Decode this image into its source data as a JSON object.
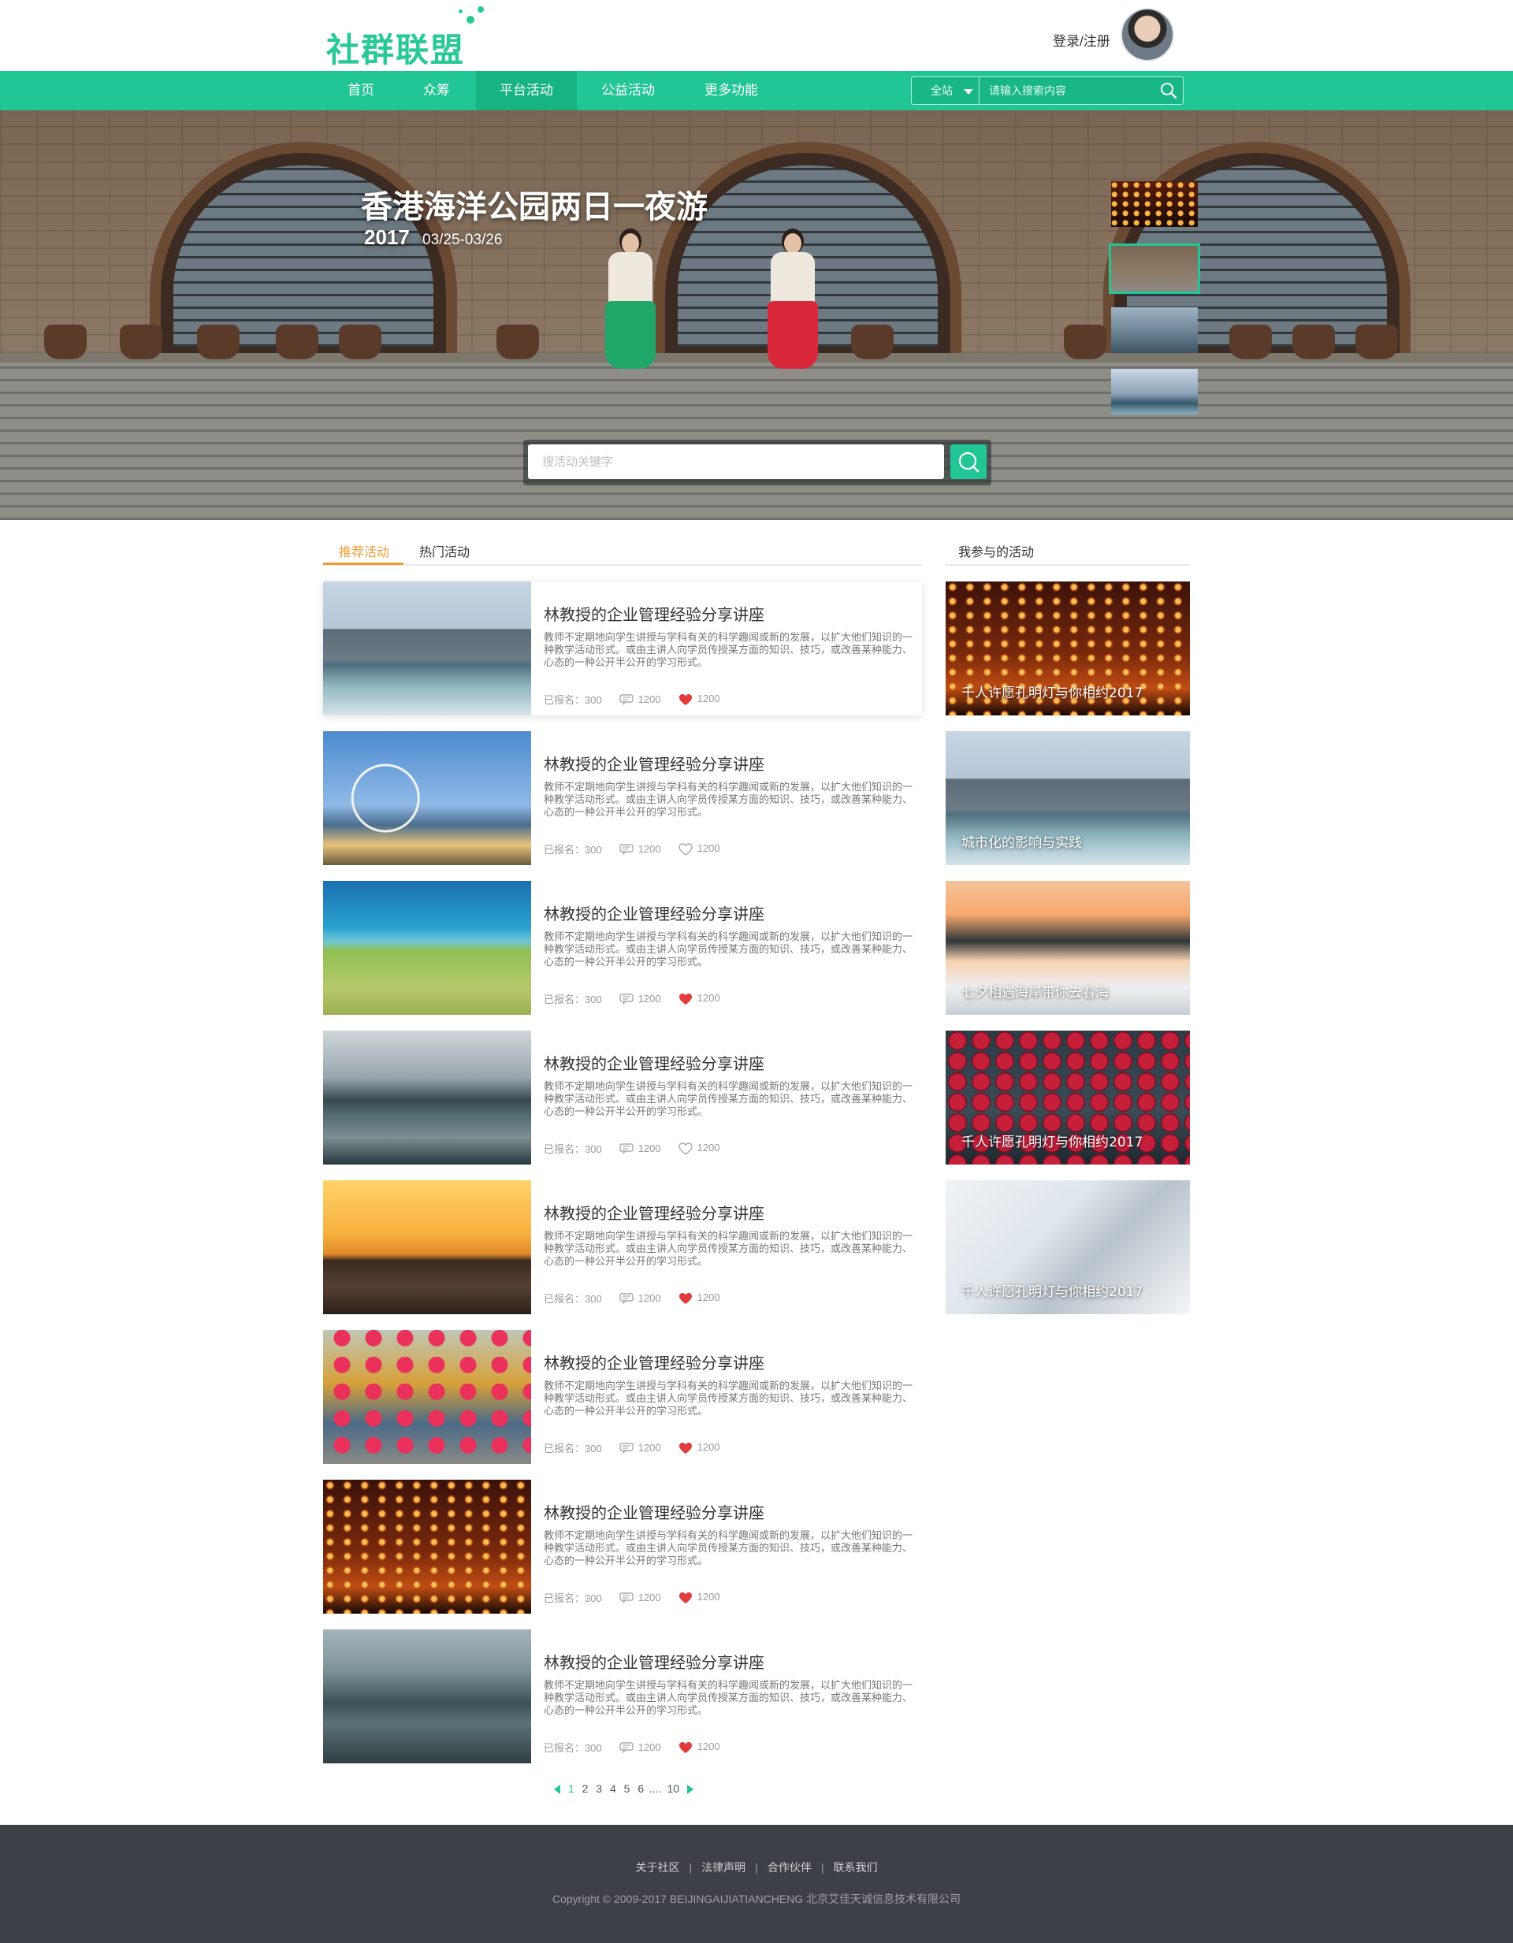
{
  "header": {
    "logo_text": "社群联盟",
    "login_label": "登录/注册"
  },
  "nav": {
    "items": [
      {
        "label": "首页"
      },
      {
        "label": "众筹"
      },
      {
        "label": "平台活动",
        "active": true
      },
      {
        "label": "公益活动"
      },
      {
        "label": "更多功能"
      }
    ],
    "search": {
      "scope_label": "全站",
      "placeholder": "请输入搜索内容"
    }
  },
  "hero": {
    "title": "香港海洋公园两日一夜游",
    "year": "2017",
    "dates": "03/25-03/26",
    "search_placeholder": "搜活动关键字",
    "thumbnails": [
      "lanterns",
      "village",
      "mountains",
      "city"
    ],
    "active_thumbnail": 1
  },
  "tabs": {
    "items": [
      {
        "label": "推荐活动",
        "active": true
      },
      {
        "label": "热门活动"
      }
    ],
    "side_label": "我参与的活动"
  },
  "activities": [
    {
      "title": "林教授的企业管理经验分享讲座",
      "desc": "教师不定期地向学生讲授与学科有关的科学趣闻或新的发展，以扩大他们知识的一种教学活动形式。或由主讲人向学员传授某方面的知识、技巧，或改善某种能力、心态的一种公开半公开的学习形式。",
      "registered": "已报名：300",
      "comments": "1200",
      "likes": "1200",
      "liked": true,
      "image": "city"
    },
    {
      "title": "林教授的企业管理经验分享讲座",
      "desc": "教师不定期地向学生讲授与学科有关的科学趣闻或新的发展，以扩大他们知识的一种教学活动形式。或由主讲人向学员传授某方面的知识、技巧，或改善某种能力、心态的一种公开半公开的学习形式。",
      "registered": "已报名：300",
      "comments": "1200",
      "likes": "1200",
      "liked": false,
      "image": "ferris"
    },
    {
      "title": "林教授的企业管理经验分享讲座",
      "desc": "教师不定期地向学生讲授与学科有关的科学趣闻或新的发展，以扩大他们知识的一种教学活动形式。或由主讲人向学员传授某方面的知识、技巧，或改善某种能力、心态的一种公开半公开的学习形式。",
      "registered": "已报名：300",
      "comments": "1200",
      "likes": "1200",
      "liked": true,
      "image": "coast"
    },
    {
      "title": "林教授的企业管理经验分享讲座",
      "desc": "教师不定期地向学生讲授与学科有关的科学趣闻或新的发展，以扩大他们知识的一种教学活动形式。或由主讲人向学员传授某方面的知识、技巧，或改善某种能力、心态的一种公开半公开的学习形式。",
      "registered": "已报名：300",
      "comments": "1200",
      "likes": "1200",
      "liked": false,
      "image": "lake"
    },
    {
      "title": "林教授的企业管理经验分享讲座",
      "desc": "教师不定期地向学生讲授与学科有关的科学趣闻或新的发展，以扩大他们知识的一种教学活动形式。或由主讲人向学员传授某方面的知识、技巧，或改善某种能力、心态的一种公开半公开的学习形式。",
      "registered": "已报名：300",
      "comments": "1200",
      "likes": "1200",
      "liked": true,
      "image": "sunset"
    },
    {
      "title": "林教授的企业管理经验分享讲座",
      "desc": "教师不定期地向学生讲授与学科有关的科学趣闻或新的发展，以扩大他们知识的一种教学活动形式。或由主讲人向学员传授某方面的知识、技巧，或改善某种能力、心态的一种公开半公开的学习形式。",
      "registered": "已报名：300",
      "comments": "1200",
      "likes": "1200",
      "liked": true,
      "image": "flowers"
    },
    {
      "title": "林教授的企业管理经验分享讲座",
      "desc": "教师不定期地向学生讲授与学科有关的科学趣闻或新的发展，以扩大他们知识的一种教学活动形式。或由主讲人向学员传授某方面的知识、技巧，或改善某种能力、心态的一种公开半公开的学习形式。",
      "registered": "已报名：300",
      "comments": "1200",
      "likes": "1200",
      "liked": true,
      "image": "lanterns"
    },
    {
      "title": "林教授的企业管理经验分享讲座",
      "desc": "教师不定期地向学生讲授与学科有关的科学趣闻或新的发展，以扩大他们知识的一种教学活动形式。或由主讲人向学员传授某方面的知识、技巧，或改善某种能力、心态的一种公开半公开的学习形式。",
      "registered": "已报名：300",
      "comments": "1200",
      "likes": "1200",
      "liked": true,
      "image": "mountains"
    }
  ],
  "my_activities": [
    {
      "title": "千人许愿孔明灯与你相约2017",
      "image": "lanterns"
    },
    {
      "title": "城市化的影响与实践",
      "image": "city"
    },
    {
      "title": "七夕相遇海岸带你去看海",
      "image": "snowriver"
    },
    {
      "title": "千人许愿孔明灯与你相约2017",
      "image": "berries"
    },
    {
      "title": "千人许愿孔明灯与你相约2017",
      "image": "snowclimb"
    }
  ],
  "pagination": {
    "current": "1",
    "pages": [
      "2",
      "3",
      "4",
      "5",
      "6"
    ],
    "ellipsis": "....",
    "last": "10"
  },
  "footer": {
    "links": [
      "关于社区",
      "法律声明",
      "合作伙伴",
      "联系我们"
    ],
    "copyright": "Copyright © 2009-2017 BEIJINGAIJIATIANCHENG 北京艾佳天诚信息技术有限公司"
  },
  "colors": {
    "brand": "#22c595",
    "accent_orange": "#f29a32",
    "like_red": "#e23b3b",
    "footer_bg": "#3e4047"
  }
}
